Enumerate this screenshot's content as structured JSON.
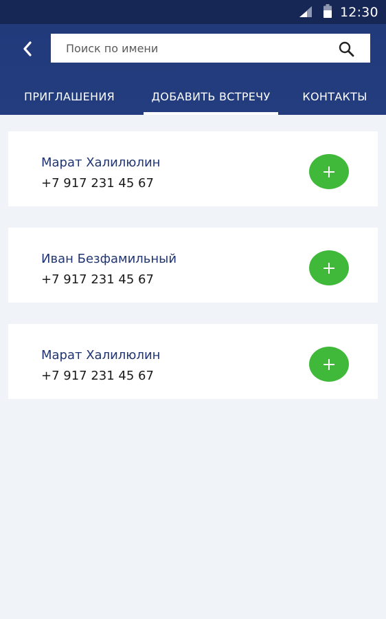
{
  "status_bar": {
    "time": "12:30",
    "icons": [
      "signal-icon",
      "battery-icon"
    ]
  },
  "header": {
    "back_icon": "chevron-left-icon",
    "search": {
      "value": "",
      "placeholder": "Поиск по имени",
      "icon": "search-icon"
    }
  },
  "tabs": [
    {
      "label": "ПРИГЛАШЕНИЯ",
      "active": false
    },
    {
      "label": "ДОБАВИТЬ ВСТРЕЧУ",
      "active": true
    },
    {
      "label": "КОНТАКТЫ",
      "active": false
    }
  ],
  "contacts": [
    {
      "name": "Марат Халилюлин",
      "phone": "+7 917 231 45 67"
    },
    {
      "name": "Иван Безфамильный",
      "phone": "+7 917 231 45 67"
    },
    {
      "name": "Марат Халилюлин",
      "phone": "+7 917 231 45 67"
    }
  ],
  "colors": {
    "status_bar": "#162755",
    "app_bar": "#213a7a",
    "background": "#f0f3f7",
    "add_button": "#40b93a",
    "name_text": "#1f3470"
  }
}
